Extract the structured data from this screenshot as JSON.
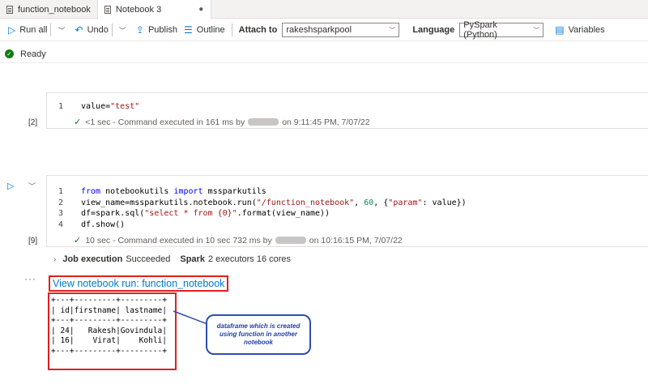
{
  "tabs": [
    {
      "label": "function_notebook",
      "active": false
    },
    {
      "label": "Notebook 3",
      "active": true
    }
  ],
  "toolbar": {
    "run_all": "Run all",
    "undo": "Undo",
    "publish": "Publish",
    "outline": "Outline",
    "attach_to_label": "Attach to",
    "attach_to_value": "rakeshsparkpool",
    "language_label": "Language",
    "language_value": "PySpark (Python)",
    "variables": "Variables"
  },
  "status": {
    "text": "Ready"
  },
  "cell1": {
    "exec_count": "[2]",
    "lines": [
      {
        "num": "1",
        "text": "value=\"test\""
      }
    ],
    "exec_pre": "<1 sec - Command executed in 161 ms by",
    "exec_post": "on 9:11:45 PM, 7/07/22"
  },
  "cell2": {
    "exec_count": "[9]",
    "line_numbers": [
      "1",
      "2",
      "3",
      "4"
    ],
    "exec_pre": "10 sec - Command executed in 10 sec 732 ms by",
    "exec_post": "on 10:16:15 PM, 7/07/22",
    "job_label": "Job execution",
    "job_status": "Succeeded",
    "spark_label": "Spark",
    "spark_info": "2 executors 16 cores"
  },
  "output": {
    "link": "View notebook run: function_notebook",
    "table_text": "+---+---------+---------+\n| id|firstname| lastname|\n+---+---------+---------+\n| 24|   Rakesh|Govindula|\n| 16|    Virat|    Kohli|\n+---+---------+---------+",
    "annotation": "dataframe which is created using function in another notebook"
  },
  "colors": {
    "accent": "#0078d4",
    "success": "#107c10",
    "highlight": "#e02020"
  }
}
